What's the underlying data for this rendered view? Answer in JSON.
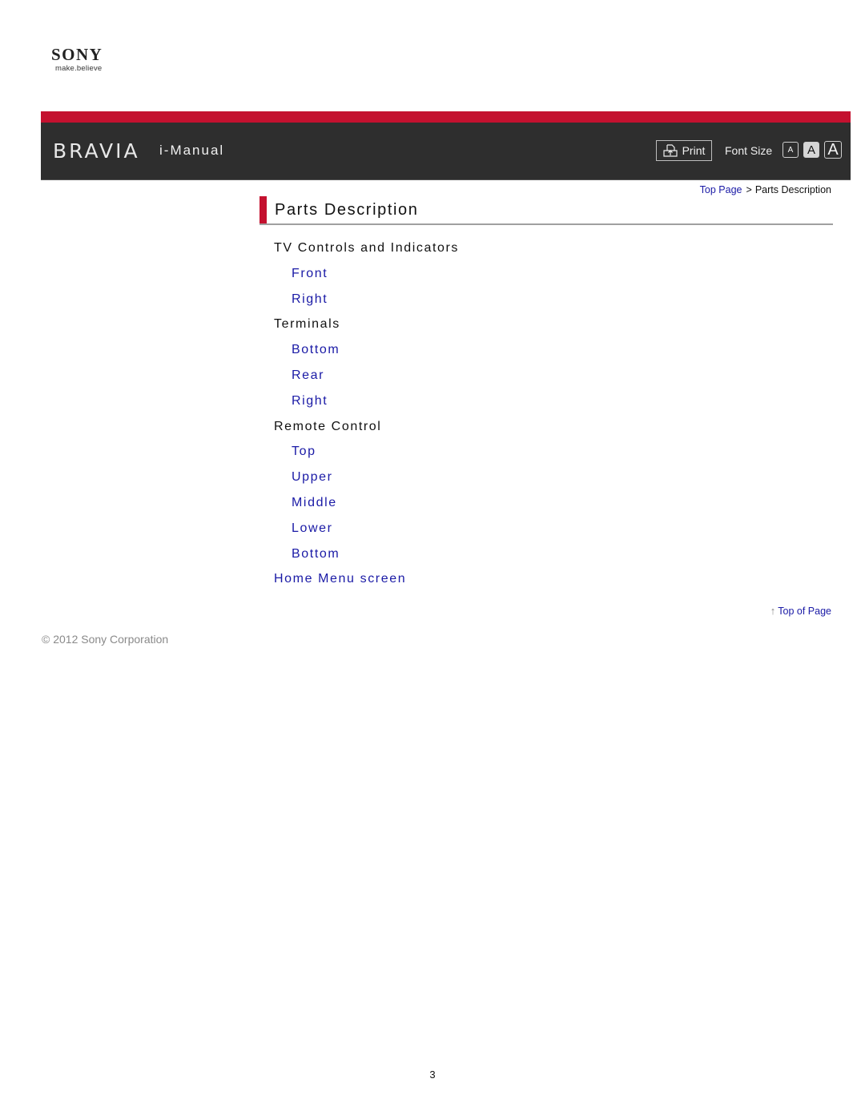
{
  "brand": {
    "logo": "SONY",
    "tagline": "make.believe"
  },
  "header": {
    "product": "BRAVIA",
    "title": "i-Manual",
    "print_label": "Print",
    "print_icon": "print-icon",
    "font_size_label": "Font Size",
    "font_size_options": [
      "A",
      "A",
      "A"
    ],
    "font_size_selected": "medium",
    "accent_color": "#c4112f",
    "bar_color": "#2e2e2e"
  },
  "breadcrumb": {
    "home": "Top Page",
    "separator": ">",
    "current": "Parts Description"
  },
  "page": {
    "title": "Parts Description"
  },
  "toc": {
    "sections": [
      {
        "label": "TV Controls and Indicators",
        "items": [
          "Front",
          "Right"
        ]
      },
      {
        "label": "Terminals",
        "items": [
          "Bottom",
          "Rear",
          "Right"
        ]
      },
      {
        "label": "Remote Control",
        "items": [
          "Top",
          "Upper",
          "Middle",
          "Lower",
          "Bottom"
        ]
      }
    ],
    "home_menu_link": "Home Menu screen",
    "link_color": "#1a1aa6"
  },
  "footer": {
    "top_of_page": "Top of Page",
    "copyright": "© 2012 Sony Corporation",
    "page_number": "3"
  }
}
